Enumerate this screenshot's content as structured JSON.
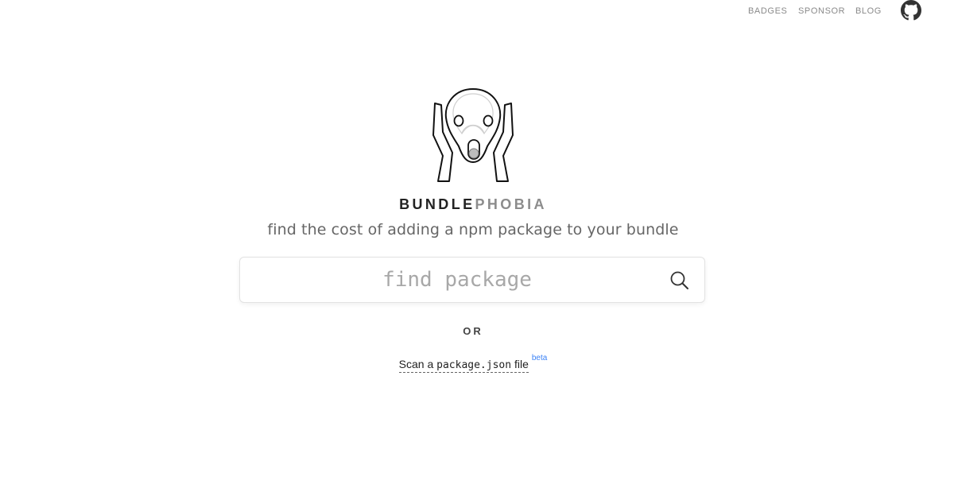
{
  "nav": {
    "badges": "BADGES",
    "sponsor": "SPONSOR",
    "blog": "BLOG",
    "github_icon": "github-icon"
  },
  "brand": {
    "part1": "BUNDLE",
    "part2": "PHOBIA",
    "logo_icon": "screaming-face-logo"
  },
  "tagline": "find the cost of adding a npm package to your bundle",
  "search": {
    "placeholder": "find package",
    "value": "",
    "icon": "search-icon"
  },
  "or_label": "OR",
  "scan": {
    "prefix": "Scan a ",
    "filename": "package.json",
    "suffix": " file",
    "badge": "beta"
  },
  "colors": {
    "brand_dark": "#222222",
    "brand_light": "#8c8c8c",
    "nav_text": "#8a8a8a",
    "beta_accent": "#3b82f6"
  }
}
